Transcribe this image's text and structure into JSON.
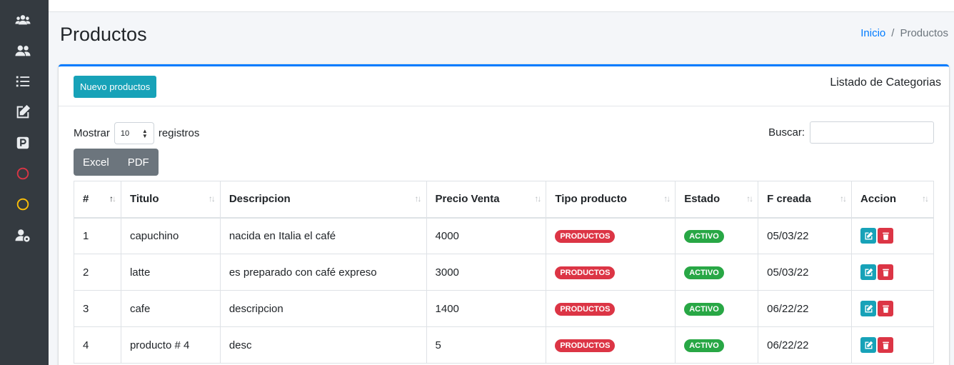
{
  "page": {
    "title": "Productos"
  },
  "breadcrumb": {
    "home": "Inicio",
    "separator": "/",
    "current": "Productos"
  },
  "sidebar": {
    "items": [
      {
        "icon": "users-group-icon"
      },
      {
        "icon": "users-icon"
      },
      {
        "icon": "list-icon"
      },
      {
        "icon": "edit-icon"
      },
      {
        "icon": "parking-icon"
      },
      {
        "icon": "circle-red-icon"
      },
      {
        "icon": "circle-yellow-icon"
      },
      {
        "icon": "user-gear-icon"
      }
    ]
  },
  "card": {
    "new_button": "Nuevo productos",
    "title": "Listado de Categorias"
  },
  "controls": {
    "show_label": "Mostrar",
    "page_length": "10",
    "records_label": "registros",
    "search_label": "Buscar:",
    "search_value": "",
    "export_excel": "Excel",
    "export_pdf": "PDF"
  },
  "table": {
    "columns": [
      "#",
      "Titulo",
      "Descripcion",
      "Precio Venta",
      "Tipo producto",
      "Estado",
      "F creada",
      "Accion"
    ],
    "rows": [
      {
        "id": "1",
        "titulo": "capuchino",
        "descripcion": "nacida en Italia el café",
        "precio": "4000",
        "tipo": "PRODUCTOS",
        "estado": "ACTIVO",
        "fecha": "05/03/22"
      },
      {
        "id": "2",
        "titulo": "latte",
        "descripcion": "es preparado con café expreso",
        "precio": "3000",
        "tipo": "PRODUCTOS",
        "estado": "ACTIVO",
        "fecha": "05/03/22"
      },
      {
        "id": "3",
        "titulo": "cafe",
        "descripcion": "descripcion",
        "precio": "1400",
        "tipo": "PRODUCTOS",
        "estado": "ACTIVO",
        "fecha": "06/22/22"
      },
      {
        "id": "4",
        "titulo": "producto # 4",
        "descripcion": "desc",
        "precio": "5",
        "tipo": "PRODUCTOS",
        "estado": "ACTIVO",
        "fecha": "06/22/22"
      }
    ]
  },
  "colors": {
    "primary": "#007bff",
    "info": "#17a2b8",
    "danger": "#dc3545",
    "success": "#28a745",
    "sidebar": "#343a40"
  }
}
